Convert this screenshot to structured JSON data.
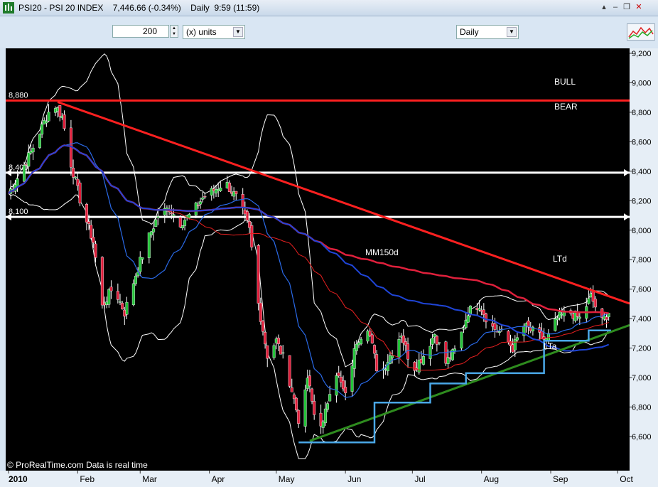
{
  "window": {
    "title": "PSI20 - PSI 20 INDEX    7,446.66 (-0.34%)    Daily  9:59 (11:59)"
  },
  "toolbar": {
    "units_value": "200",
    "units_label": "(x) units",
    "period_label": "Daily"
  },
  "chart_data": {
    "type": "candlestick",
    "title": "PSI20 - PSI 20 INDEX",
    "ylim": [
      6450,
      9250
    ],
    "y_ticks": [
      "9,200",
      "9,000",
      "8,800",
      "8,600",
      "8,400",
      "8,200",
      "8,000",
      "7,800",
      "7,600",
      "7,400",
      "7,200",
      "7,000",
      "6,800",
      "6,600"
    ],
    "y_tick_values": [
      9200,
      9000,
      8800,
      8600,
      8400,
      8200,
      8000,
      7800,
      7600,
      7400,
      7200,
      7000,
      6800,
      6600
    ],
    "x_labels": [
      "2010",
      "Feb",
      "Mar",
      "Apr",
      "May",
      "Jun",
      "Jul",
      "Aug",
      "Sep",
      "Oct"
    ],
    "x_label_days": [
      0,
      31,
      59,
      90,
      120,
      151,
      181,
      212,
      243,
      273
    ],
    "horizontal_levels": [
      {
        "label": "8,880",
        "value": 8880,
        "color": "#ff2020"
      },
      {
        "label": "8,400",
        "value": 8390,
        "color": "#ffffff"
      },
      {
        "label": "8,100",
        "value": 8090,
        "color": "#ffffff"
      }
    ],
    "annotations": [
      "BULL",
      "BEAR",
      "MM150d",
      "LTd",
      "LTa"
    ],
    "trendlines": [
      {
        "name": "LTd",
        "from": [
          22,
          8870
        ],
        "to": [
          290,
          7440
        ],
        "color": "#ff2020"
      },
      {
        "name": "LTa",
        "from": [
          135,
          6570
        ],
        "to": [
          290,
          7420
        ],
        "color": "#2e8b1e"
      }
    ],
    "step_support": {
      "color": "#4aa8e8",
      "points": [
        [
          130,
          6560
        ],
        [
          164,
          6560
        ],
        [
          164,
          6830
        ],
        [
          189,
          6830
        ],
        [
          189,
          6960
        ],
        [
          205,
          6960
        ],
        [
          205,
          7030
        ],
        [
          240,
          7030
        ],
        [
          240,
          7250
        ],
        [
          260,
          7250
        ],
        [
          260,
          7320
        ],
        [
          270,
          7320
        ]
      ]
    },
    "close_series": {
      "x": [
        0,
        5,
        10,
        15,
        20,
        24,
        28,
        33,
        38,
        42,
        47,
        52,
        57,
        62,
        67,
        72,
        77,
        82,
        87,
        92,
        97,
        103,
        108,
        112,
        116,
        120,
        124,
        128,
        131,
        134,
        137,
        141,
        146,
        151,
        156,
        161,
        166,
        171,
        176,
        181,
        186,
        191,
        196,
        201,
        206,
        211,
        216,
        221,
        226,
        231,
        236,
        241,
        246,
        251,
        256,
        261,
        266,
        269
      ],
      "y": [
        8250,
        8380,
        8530,
        8700,
        8870,
        8770,
        8450,
        8150,
        7920,
        7480,
        7620,
        7440,
        7700,
        7920,
        8100,
        8150,
        8050,
        8110,
        8220,
        8270,
        8330,
        8200,
        8000,
        7500,
        7150,
        7250,
        7100,
        6850,
        6650,
        7000,
        6750,
        6680,
        7080,
        6870,
        7250,
        7350,
        7000,
        7150,
        7300,
        7050,
        7150,
        7300,
        7100,
        7200,
        7450,
        7500,
        7350,
        7300,
        7200,
        7350,
        7300,
        7250,
        7400,
        7450,
        7400,
        7550,
        7380,
        7446
      ]
    },
    "indicators": [
      {
        "name": "MM150d",
        "color": "#e0203c"
      },
      {
        "name": "MA50",
        "color": "#e82020"
      },
      {
        "name": "MA20",
        "color": "#2a6ae8"
      },
      {
        "name": "Bollinger Bands",
        "color": "#ffffff"
      }
    ],
    "watermark": "© ProRealTime.com  Data is real time"
  }
}
